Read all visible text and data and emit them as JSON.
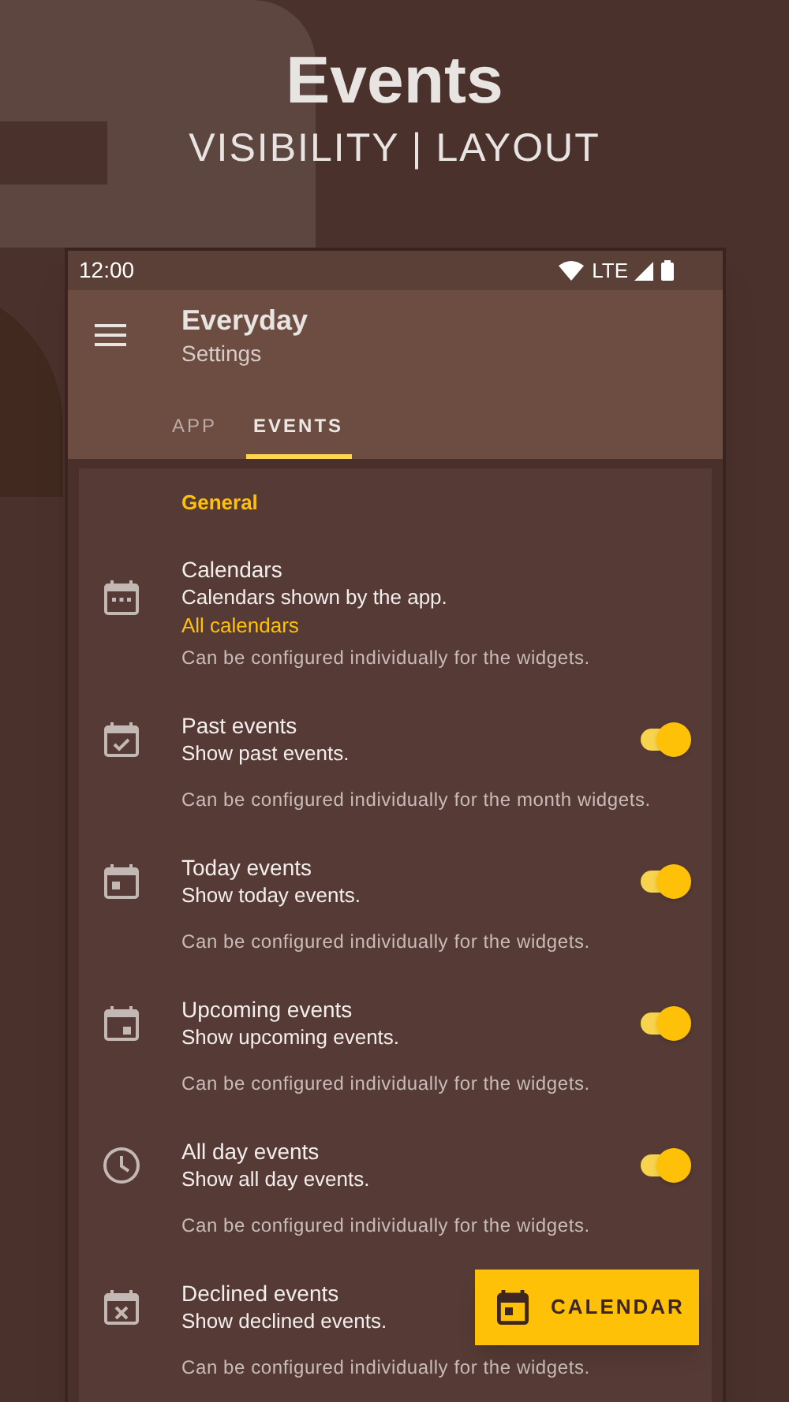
{
  "header": {
    "title": "Events",
    "subtitle": "VISIBILITY | LAYOUT"
  },
  "status_bar": {
    "time": "12:00",
    "network": "LTE"
  },
  "app_bar": {
    "title": "Everyday",
    "subtitle": "Settings"
  },
  "tabs": [
    {
      "label": "APP",
      "selected": false
    },
    {
      "label": "EVENTS",
      "selected": true
    }
  ],
  "section": {
    "title": "General"
  },
  "settings": [
    {
      "kind": "link",
      "title": "Calendars",
      "summary": "Calendars shown by the app.",
      "value": "All calendars",
      "note": "Can be configured individually for the widgets."
    },
    {
      "kind": "switch",
      "title": "Past events",
      "summary": "Show past events.",
      "on": true,
      "note": "Can be configured individually for the month widgets."
    },
    {
      "kind": "switch",
      "title": "Today events",
      "summary": "Show today events.",
      "on": true,
      "note": "Can be configured individually for the widgets."
    },
    {
      "kind": "switch",
      "title": "Upcoming events",
      "summary": "Show upcoming events.",
      "on": true,
      "note": "Can be configured individually for the widgets."
    },
    {
      "kind": "switch",
      "title": "All day events",
      "summary": "Show all day events.",
      "on": true,
      "note": "Can be configured individually for the widgets."
    },
    {
      "kind": "plain",
      "title": "Declined events",
      "summary": "Show declined events.",
      "note": "Can be configured individually for the widgets."
    }
  ],
  "fab": {
    "label": "CALENDAR"
  }
}
